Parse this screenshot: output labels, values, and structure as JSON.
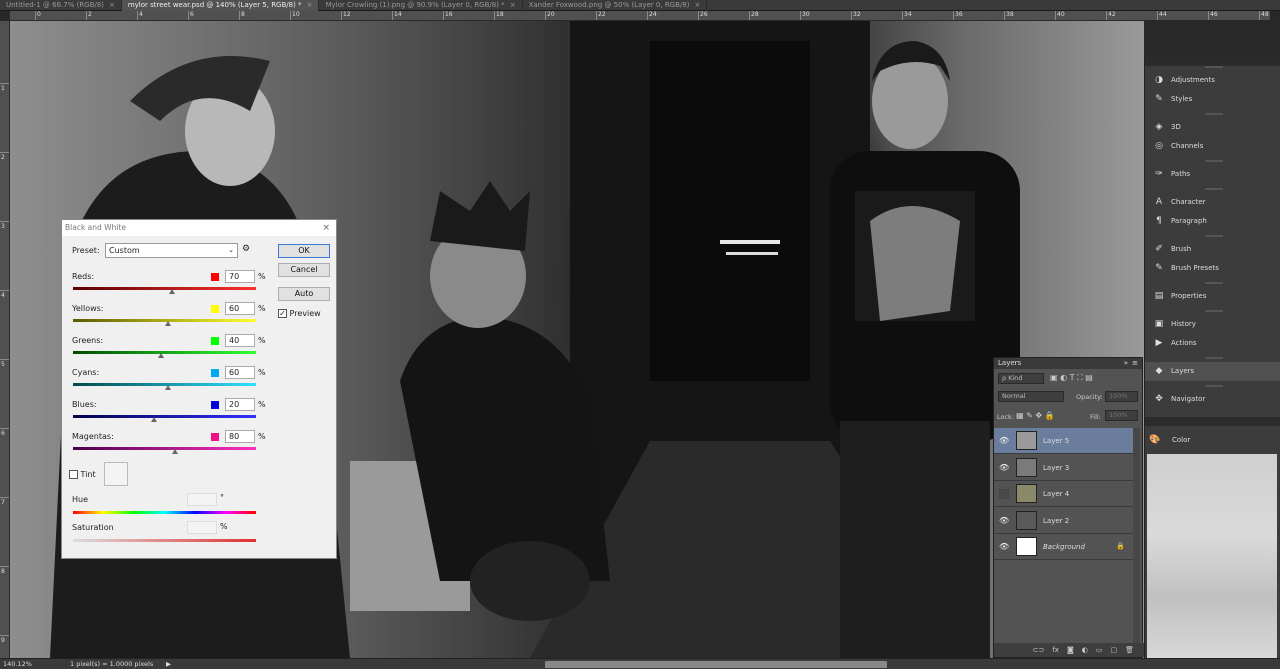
{
  "tabs": [
    {
      "label": "Untitled-1 @ 66.7% (RGB/8)",
      "active": false
    },
    {
      "label": "mylor street wear.psd @ 140% (Layer 5, RGB/8) *",
      "active": true
    },
    {
      "label": "Mylor Crowling (1).png @ 90.9% (Layer 0, RGB/8) *",
      "active": false
    },
    {
      "label": "Xander Foxwood.png @ 50% (Layer 0, RGB/8)",
      "active": false
    }
  ],
  "tab_close": "×",
  "ruler_top": [
    "0",
    "2",
    "4",
    "6",
    "8",
    "10",
    "12",
    "14",
    "16",
    "18",
    "20",
    "22",
    "24",
    "26",
    "28",
    "30",
    "32",
    "34",
    "36",
    "38",
    "40",
    "42",
    "44",
    "46",
    "48",
    "50"
  ],
  "ruler_left": [
    "1",
    "2",
    "3",
    "4",
    "5",
    "6",
    "7",
    "8",
    "9"
  ],
  "dialog": {
    "title": "Black and White",
    "close": "×",
    "preset_label": "Preset:",
    "preset_value": "Custom",
    "buttons": {
      "ok": "OK",
      "cancel": "Cancel",
      "auto": "Auto"
    },
    "preview_label": "Preview",
    "preview_checked": true,
    "channels": [
      {
        "label": "Reds:",
        "value": "70",
        "swatch": "#ff0000"
      },
      {
        "label": "Yellows:",
        "value": "60",
        "swatch": "#ffff00"
      },
      {
        "label": "Greens:",
        "value": "40",
        "swatch": "#00ff00"
      },
      {
        "label": "Cyans:",
        "value": "60",
        "swatch": "#00aaee"
      },
      {
        "label": "Blues:",
        "value": "20",
        "swatch": "#0000dd"
      },
      {
        "label": "Magentas:",
        "value": "80",
        "swatch": "#ee1188"
      }
    ],
    "percent": "%",
    "tint_label": "Tint",
    "hue_label": "Hue",
    "hue_unit": "°",
    "saturation_label": "Saturation",
    "saturation_unit": "%"
  },
  "dock": {
    "items": [
      {
        "label": "Adjustments",
        "icon": "adjustments-icon",
        "glyph": "◑"
      },
      {
        "label": "Styles",
        "icon": "styles-icon",
        "glyph": "✎"
      },
      {
        "label": "3D",
        "icon": "3d-icon",
        "glyph": "◈"
      },
      {
        "label": "Channels",
        "icon": "channels-icon",
        "glyph": "◎"
      },
      {
        "label": "Paths",
        "icon": "paths-icon",
        "glyph": "✑"
      },
      {
        "label": "Character",
        "icon": "character-icon",
        "glyph": "A"
      },
      {
        "label": "Paragraph",
        "icon": "paragraph-icon",
        "glyph": "¶"
      },
      {
        "label": "Brush",
        "icon": "brush-icon",
        "glyph": "✐"
      },
      {
        "label": "Brush Presets",
        "icon": "brush-presets-icon",
        "glyph": "✎"
      },
      {
        "label": "Properties",
        "icon": "properties-icon",
        "glyph": "▤"
      },
      {
        "label": "History",
        "icon": "history-icon",
        "glyph": "▣"
      },
      {
        "label": "Actions",
        "icon": "actions-icon",
        "glyph": "▶"
      },
      {
        "label": "Layers",
        "icon": "layers-icon",
        "glyph": "◆"
      },
      {
        "label": "Navigator",
        "icon": "navigator-icon",
        "glyph": "✥"
      }
    ]
  },
  "color_panel": {
    "title": "Color",
    "icon": "color-icon"
  },
  "layers_panel": {
    "title": "Layers",
    "kind_label": "ρ Kind",
    "blend_mode": "Normal",
    "opacity_label": "Opacity:",
    "opacity_value": "100%",
    "lock_label": "Lock:",
    "fill_label": "Fill:",
    "fill_value": "100%",
    "layers": [
      {
        "name": "Layer 5",
        "visible": true,
        "selected": true
      },
      {
        "name": "Layer 3",
        "visible": true,
        "selected": false
      },
      {
        "name": "Layer 4",
        "visible": false,
        "selected": false
      },
      {
        "name": "Layer 2",
        "visible": true,
        "selected": false
      },
      {
        "name": "Background",
        "visible": true,
        "selected": false,
        "locked": true
      }
    ],
    "footer_icons": [
      "link-icon",
      "fx-icon",
      "mask-icon",
      "adjustment-layer-icon",
      "group-icon",
      "new-layer-icon",
      "trash-icon"
    ],
    "footer_glyphs": [
      "⊂⊃",
      "fx",
      "◙",
      "◐",
      "▭",
      "▢",
      "🗑"
    ]
  },
  "status": {
    "zoom": "140.12%",
    "info": "1 pixel(s) = 1.0000 pixels",
    "arrow": "▶"
  }
}
